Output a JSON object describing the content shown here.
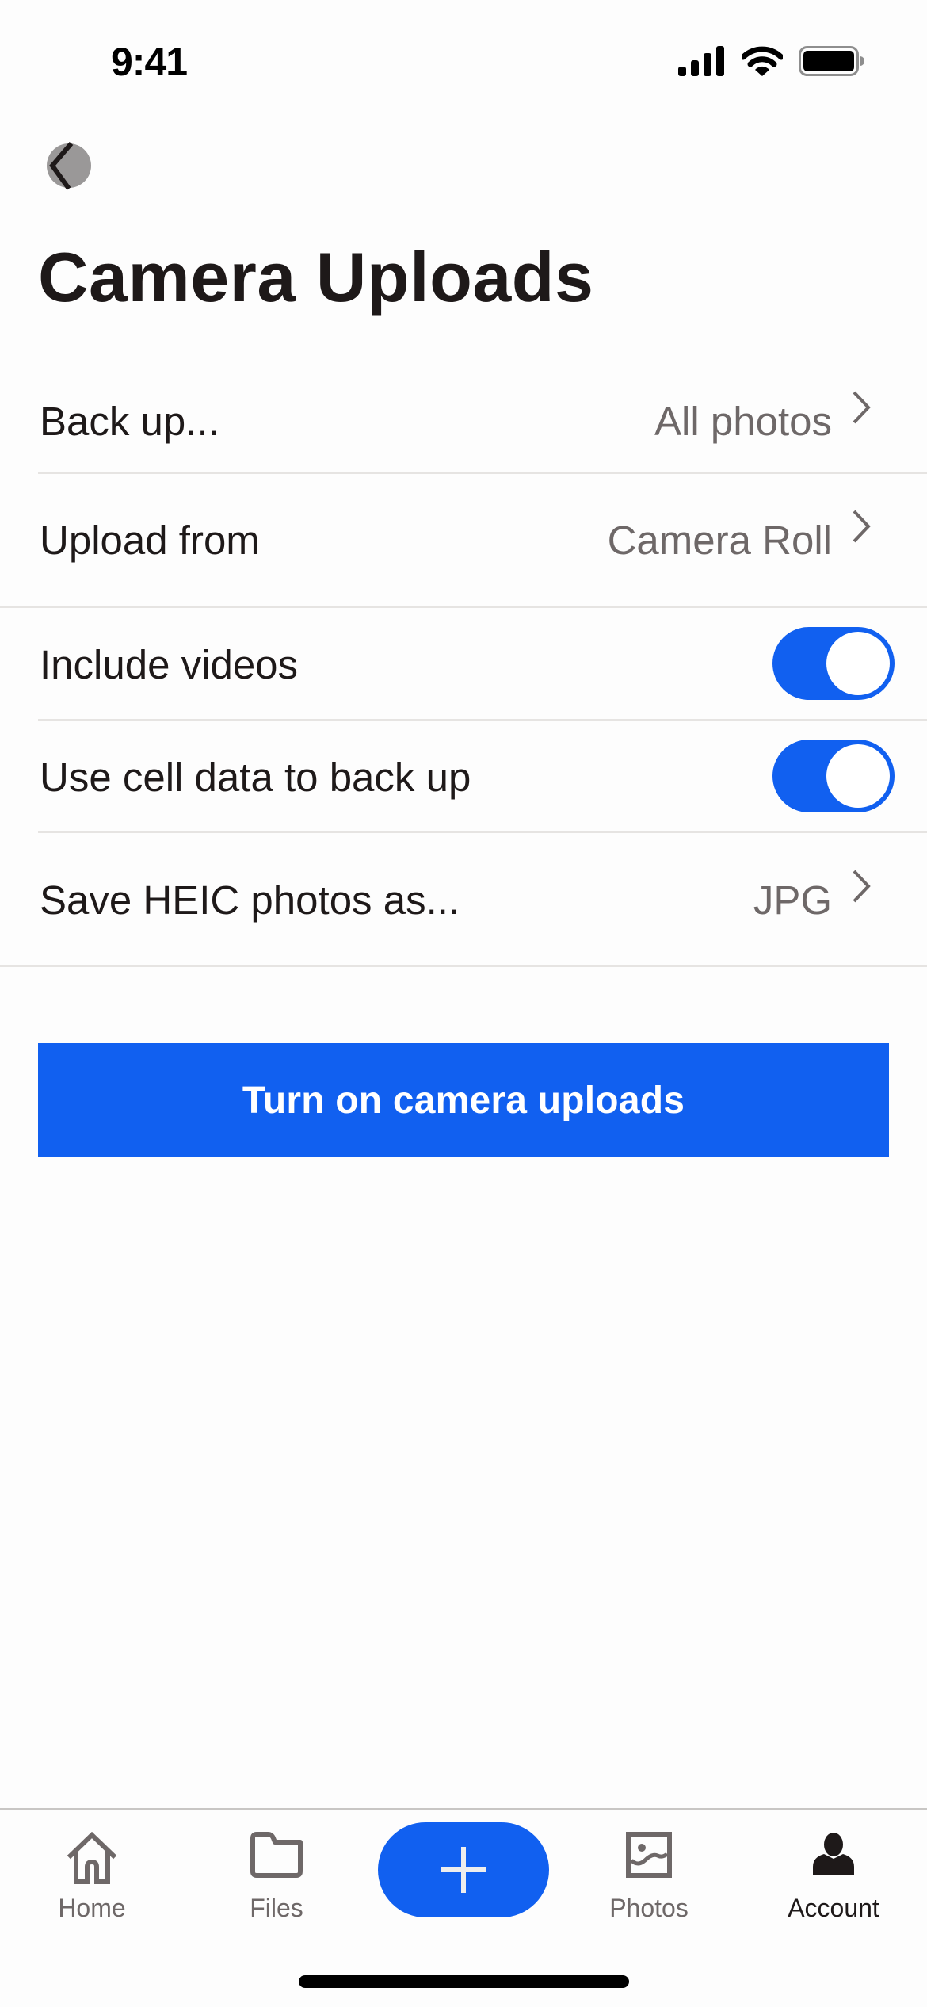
{
  "status_bar": {
    "time": "9:41",
    "icons": [
      "cellular-signal-icon",
      "wifi-icon",
      "battery-icon"
    ]
  },
  "header": {
    "back_icon": "chevron-left-icon",
    "title": "Camera Uploads"
  },
  "settings": [
    {
      "label": "Back up...",
      "type": "link",
      "value": "All photos"
    },
    {
      "label": "Upload from",
      "type": "link",
      "value": "Camera Roll"
    },
    {
      "label": "Include videos",
      "type": "toggle",
      "on": true
    },
    {
      "label": "Use cell data to back up",
      "type": "toggle",
      "on": true
    },
    {
      "label": "Save HEIC photos as...",
      "type": "link",
      "value": "JPG"
    }
  ],
  "primary_button": {
    "label": "Turn on camera uploads"
  },
  "tab_bar": {
    "tabs": [
      {
        "label": "Home",
        "icon": "home-icon",
        "active": false
      },
      {
        "label": "Files",
        "icon": "folder-icon",
        "active": false
      },
      {
        "label": "Photos",
        "icon": "photo-icon",
        "active": false
      },
      {
        "label": "Account",
        "icon": "person-icon",
        "active": true
      }
    ],
    "create_icon": "plus-icon"
  },
  "colors": {
    "accent": "#1160f0",
    "text_primary": "#1e1919",
    "text_secondary": "#6e6868",
    "divider": "#e6e4e2"
  }
}
